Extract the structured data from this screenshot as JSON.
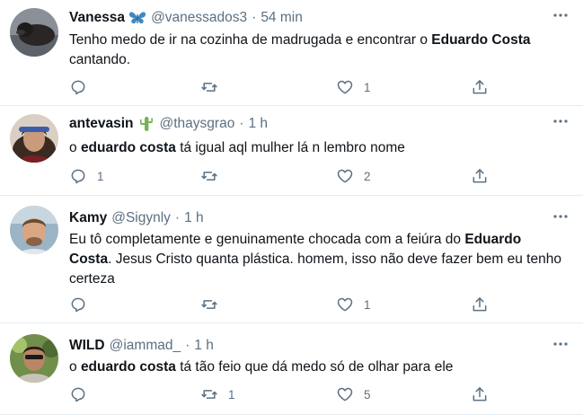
{
  "tweets": [
    {
      "display_name": "Vanessa",
      "emoji": "butterfly-emoji",
      "handle": "@vanessados3",
      "separator": "·",
      "time": "54 min",
      "text_parts": [
        {
          "t": "Tenho medo de ir na cozinha de madrugada e encontrar o ",
          "b": false
        },
        {
          "t": "Eduardo Costa",
          "b": true
        },
        {
          "t": " cantando.",
          "b": false
        }
      ],
      "reply_count": "",
      "retweet_count": "",
      "like_count": "1"
    },
    {
      "display_name": "antevasin",
      "emoji": "cactus-emoji",
      "handle": "@thaysgrao",
      "separator": "·",
      "time": "1 h",
      "text_parts": [
        {
          "t": "o ",
          "b": false
        },
        {
          "t": "eduardo costa",
          "b": true
        },
        {
          "t": " tá igual aql mulher lá n lembro nome",
          "b": false
        }
      ],
      "reply_count": "1",
      "retweet_count": "",
      "like_count": "2"
    },
    {
      "display_name": "Kamy",
      "emoji": "",
      "handle": "@Sigynly",
      "separator": "·",
      "time": "1 h",
      "text_parts": [
        {
          "t": "Eu tô completamente e genuinamente chocada com a feiúra do ",
          "b": false
        },
        {
          "t": "Eduardo Costa",
          "b": true
        },
        {
          "t": ". Jesus Cristo quanta plástica. homem, isso não deve fazer bem eu tenho certeza",
          "b": false
        }
      ],
      "reply_count": "",
      "retweet_count": "",
      "like_count": "1"
    },
    {
      "display_name": "WILD",
      "emoji": "",
      "handle": "@iammad_",
      "separator": "·",
      "time": "1 h",
      "text_parts": [
        {
          "t": "o ",
          "b": false
        },
        {
          "t": "eduardo costa",
          "b": true
        },
        {
          "t": " tá tão feio que dá medo só de olhar para ele",
          "b": false
        }
      ],
      "reply_count": "",
      "retweet_count": "1",
      "like_count": "5"
    }
  ],
  "icons": {
    "reply": "reply-icon",
    "retweet": "retweet-icon",
    "like": "like-icon",
    "share": "share-icon",
    "more": "more-icon"
  },
  "colors": {
    "text": "#0f1419",
    "secondary": "#5b7083",
    "divider": "#e6ecf0",
    "butterfly": "#3b88c3",
    "cactus": "#77b255"
  }
}
